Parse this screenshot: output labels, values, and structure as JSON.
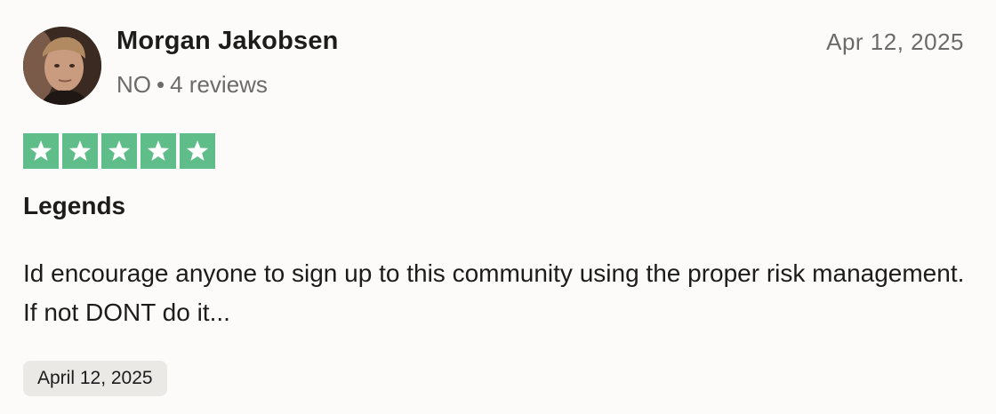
{
  "reviewer": {
    "name": "Morgan Jakobsen",
    "country": "NO",
    "separator": "•",
    "reviews_count": "4 reviews"
  },
  "review": {
    "date": "Apr 12, 2025",
    "rating": 5,
    "rating_max": 5,
    "star_color": "#5fbd8a",
    "title": "Legends",
    "body": "Id encourage anyone to sign up to this community using the proper risk management. If not DONT do it...",
    "experience_date": "April 12, 2025"
  },
  "icons": {
    "avatar": "avatar-photo",
    "star": "star-icon"
  }
}
